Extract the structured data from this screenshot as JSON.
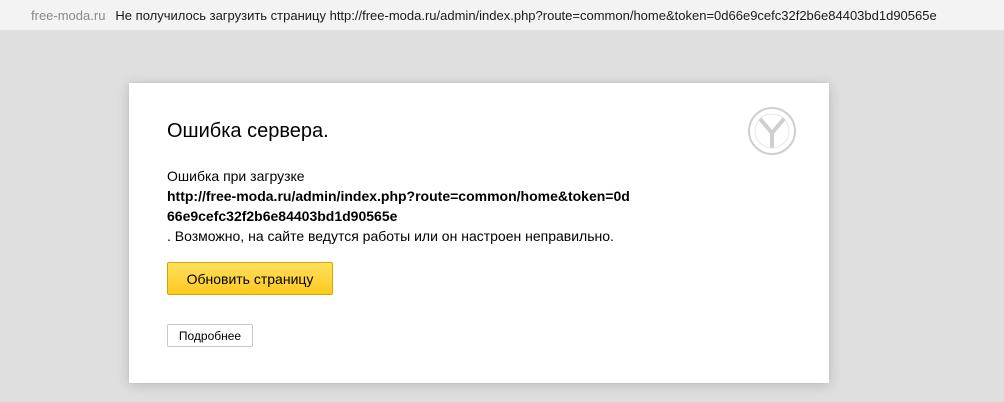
{
  "topbar": {
    "domain": "free-moda.ru",
    "message": "Не получилось загрузить страницу http://free-moda.ru/admin/index.php?route=common/home&token=0d66e9cefc32f2b6e84403bd1d90565e"
  },
  "error": {
    "title": "Ошибка сервера.",
    "prefix": "Ошибка при загрузке",
    "url": "http://free-moda.ru/admin/index.php?route=common/home&token=0d66e9cefc32f2b6e84403bd1d90565e",
    "suffix": ". Возможно, на сайте ведутся работы или он настроен неправильно."
  },
  "buttons": {
    "reload_label": "Обновить страницу",
    "details_label": "Подробнее"
  },
  "icons": {
    "logo": "yandex-browser-logo-icon"
  },
  "colors": {
    "background": "#dfdfdf",
    "card": "#ffffff",
    "accent_button": "#fdc91e"
  }
}
